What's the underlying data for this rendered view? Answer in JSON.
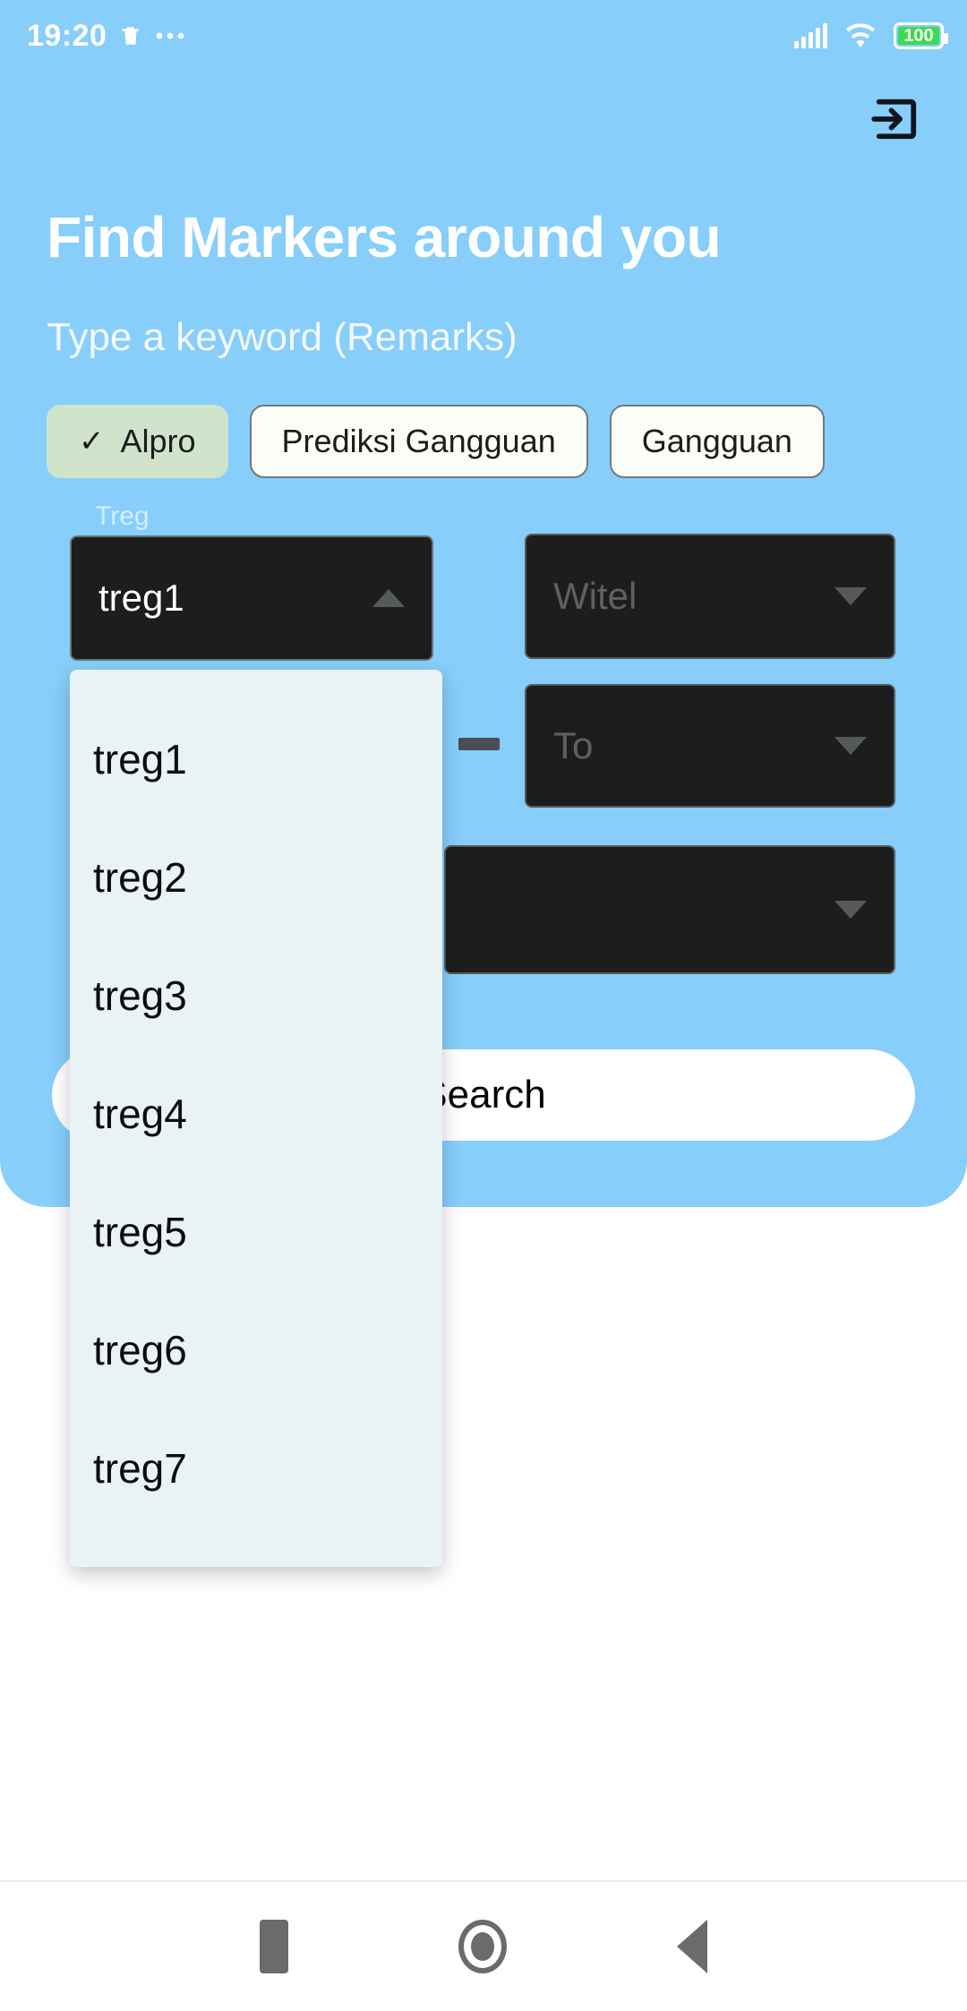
{
  "status_bar": {
    "time": "19:20",
    "trash_icon": "trash-icon",
    "more_icon": "more-dots-icon",
    "signal_icon": "signal-bars-icon",
    "wifi_icon": "wifi-icon",
    "battery_level": "100",
    "battery_color": "#3ddb4f"
  },
  "header": {
    "login_icon": "login-arrow-icon",
    "title": "Find Markers around you",
    "subtitle": "Type a keyword (Remarks)",
    "background_color": "#87CEFA"
  },
  "chips": [
    {
      "label": "Alpro",
      "selected": true,
      "check_icon": "check-icon",
      "bg": "#cfe4cb"
    },
    {
      "label": "Prediksi Gangguan",
      "selected": false,
      "bg": "#fbfdf7"
    },
    {
      "label": "Gangguan",
      "selected": false,
      "bg": "#fbfdf7"
    }
  ],
  "form": {
    "treg": {
      "label": "Treg",
      "value": "treg1",
      "expanded": true,
      "caret_icon": "chevron-up-icon"
    },
    "witel": {
      "placeholder": "Witel",
      "value": "",
      "caret_icon": "chevron-down-icon"
    },
    "range": {
      "separator": "—",
      "to": {
        "placeholder": "To",
        "value": "",
        "caret_icon": "chevron-down-icon"
      }
    },
    "extra": {
      "placeholder": "",
      "value": "",
      "caret_icon": "chevron-down-icon"
    },
    "search_label": "Search"
  },
  "treg_menu": {
    "background": "#e9f3f5",
    "items": [
      {
        "label": "treg1"
      },
      {
        "label": "treg2"
      },
      {
        "label": "treg3"
      },
      {
        "label": "treg4"
      },
      {
        "label": "treg5"
      },
      {
        "label": "treg6"
      },
      {
        "label": "treg7"
      }
    ]
  },
  "navbar": {
    "recents_icon": "square-recents-icon",
    "home_icon": "circle-home-icon",
    "back_icon": "triangle-back-icon"
  }
}
